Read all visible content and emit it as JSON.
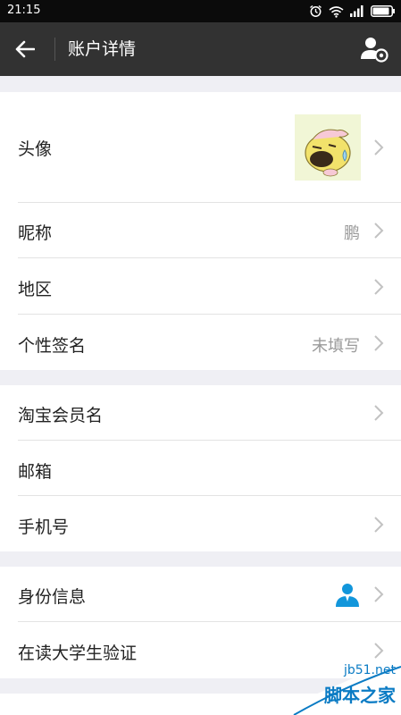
{
  "status_bar": {
    "time": "21:15",
    "icons": [
      "alarm-icon",
      "wifi-icon",
      "signal-icon",
      "battery-icon"
    ]
  },
  "header": {
    "title": "账户详情"
  },
  "group1": {
    "avatar_label": "头像",
    "nickname_label": "昵称",
    "nickname_value": "鹏",
    "region_label": "地区",
    "signature_label": "个性签名",
    "signature_value": "未填写"
  },
  "group2": {
    "taobao_label": "淘宝会员名",
    "email_label": "邮箱",
    "phone_label": "手机号"
  },
  "group3": {
    "identity_label": "身份信息",
    "student_label": "在读大学生验证"
  },
  "colors": {
    "header_bg": "#323232",
    "status_bg": "#0b0b0b",
    "page_bg": "#efeff4",
    "identity_icon": "#1296db"
  },
  "watermark": {
    "site": "jb51.net",
    "name": "脚本之家"
  }
}
